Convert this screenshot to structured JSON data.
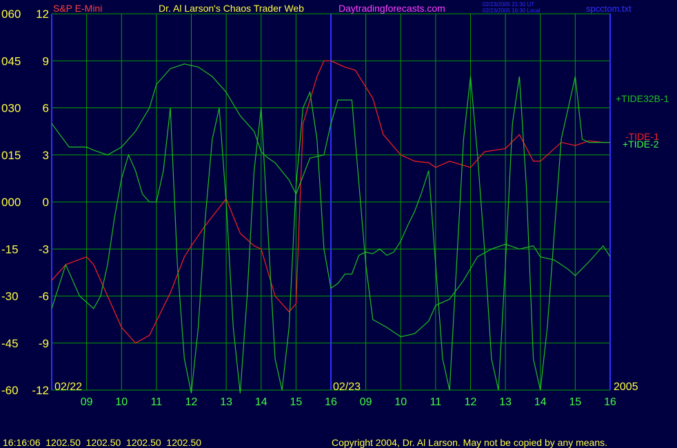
{
  "header": {
    "instrument": "S&P E-Mini",
    "title": "Dr. Al Larson's Chaos Trader Web",
    "site": "Daytradingforecasts.com",
    "stamp1": "02/23/2005 21:30 UT",
    "stamp2": "02/23/2005 16:30 Local",
    "filename": "spcctom.txt"
  },
  "footer": {
    "quote": "16:16:06  1202.50  1202.50  1202.50  1202.50",
    "copyright": "Copyright 2004, Dr. Al Larson. May not be copied by any means."
  },
  "colors": {
    "background": "#000040",
    "grid": "#00A000",
    "axis": "#3030FF",
    "label_yellow": "#FFFF40",
    "label_green": "#40FF40",
    "tide1": "#FF2020",
    "tide2": "#20C020",
    "tide32b": "#20C020",
    "title_pink": "#FF40FF"
  },
  "chart_data": {
    "type": "line",
    "left_axis_ticks": [
      "060",
      "045",
      "030",
      "015",
      "000",
      "-15",
      "-30",
      "-45",
      "-60"
    ],
    "right_axis_ticks": [
      "12",
      "9",
      "6",
      "3",
      "0",
      "-3",
      "-6",
      "-9",
      "-12"
    ],
    "ylim": [
      -12,
      12
    ],
    "date_labels": [
      "02/22",
      "02/23",
      "2005"
    ],
    "x_ticks": [
      "09",
      "10",
      "11",
      "12",
      "13",
      "14",
      "15",
      "16",
      "09",
      "10",
      "11",
      "12",
      "13",
      "14",
      "15",
      "16"
    ],
    "xlim": [
      0,
      16
    ],
    "series": [
      {
        "name": "TIDE-1",
        "x": [
          0,
          0.4,
          1,
          1.2,
          1.6,
          2,
          2.4,
          2.8,
          3,
          3.4,
          3.8,
          4,
          4.4,
          5,
          5.4,
          5.8,
          6,
          6.4,
          6.8,
          7,
          7.2,
          7.6,
          7.8,
          8,
          8.4,
          8.7,
          9.2,
          9.5,
          10,
          10.4,
          10.8,
          11,
          11.4,
          12,
          12.4,
          13,
          13.4,
          13.8,
          14,
          14.6,
          15,
          15.4,
          15.8,
          16
        ],
        "values": [
          -5,
          -4,
          -3.5,
          -4,
          -6,
          -8,
          -9,
          -8.5,
          -7.6,
          -5.8,
          -3.5,
          -2.8,
          -1.5,
          0.2,
          -2,
          -2.8,
          -3,
          -6,
          -7,
          -6.5,
          5,
          8,
          9,
          9,
          8.6,
          8.4,
          6.6,
          4.3,
          3,
          2.6,
          2.5,
          2.2,
          2.6,
          2.2,
          3.2,
          3.4,
          4.3,
          2.6,
          2.6,
          3.8,
          3.6,
          3.9,
          3.8,
          3.8
        ]
      },
      {
        "name": "TIDE-2",
        "x": [
          0,
          0.4,
          0.8,
          1.2,
          1.4,
          1.6,
          1.8,
          2,
          2.2,
          2.4,
          2.6,
          2.8,
          3,
          3.2,
          3.4,
          3.6,
          3.8,
          4,
          4.2,
          4.4,
          4.6,
          4.8,
          5,
          5.2,
          5.4,
          5.6,
          5.8,
          6,
          6.2,
          6.4,
          6.6,
          6.8,
          7,
          7.2,
          7.4,
          7.6,
          7.8,
          8,
          8.2,
          8.4,
          8.6,
          8.8,
          9,
          9.2,
          9.4,
          9.6,
          9.8,
          10,
          10.2,
          10.4,
          10.6,
          10.8,
          11,
          11.2,
          11.4,
          11.6,
          11.8,
          12,
          12.2,
          12.4,
          12.6,
          12.8,
          13,
          13.2,
          13.4,
          13.6,
          13.8,
          14,
          14.2,
          14.4,
          14.6,
          14.8,
          15,
          15.2,
          15.4,
          15.6,
          15.8,
          16
        ],
        "values": [
          -6.8,
          -4,
          -6,
          -6.8,
          -6,
          -4,
          -1,
          1.5,
          3,
          2,
          0.5,
          0,
          0,
          2,
          6,
          -4,
          -10,
          -12.2,
          -8,
          -1,
          4,
          6,
          0,
          -8,
          -12.2,
          -6,
          2,
          6,
          -2,
          -10,
          -12,
          -8,
          1,
          6,
          7,
          4,
          -3,
          -5.5,
          -5.2,
          -4.6,
          -4.6,
          -3.4,
          -3.2,
          -3.3,
          -3,
          -3.4,
          -3.2,
          -2.5,
          -1.5,
          -0.6,
          0.6,
          2,
          -4,
          -10,
          -12,
          -4,
          4,
          8,
          3,
          -3,
          -10,
          -12,
          -4,
          5,
          8,
          1,
          -10,
          -12,
          -8,
          -2,
          4,
          6,
          8,
          4,
          3.8,
          3.8,
          3.8,
          3.8
        ]
      },
      {
        "name": "TIDE32B-1",
        "x": [
          0,
          0.5,
          1,
          1.2,
          1.6,
          2,
          2.4,
          2.8,
          3,
          3.4,
          3.8,
          4.2,
          4.6,
          5,
          5.4,
          5.8,
          6,
          6.2,
          6.4,
          6.8,
          7,
          7.4,
          7.8,
          8,
          8.2,
          8.6,
          9,
          9.2,
          9.6,
          10,
          10.4,
          10.8,
          11,
          11.4,
          11.8,
          12.2,
          12.6,
          13,
          13.4,
          13.8,
          14,
          14.4,
          14.8,
          15,
          15.4,
          15.8,
          16
        ],
        "values": [
          5,
          3.5,
          3.5,
          3.3,
          3,
          3.5,
          4.5,
          6,
          7.5,
          8.5,
          8.8,
          8.6,
          8,
          7,
          5.5,
          4.5,
          3.2,
          2.8,
          2.5,
          1.4,
          0.5,
          2.8,
          3,
          5,
          6.5,
          6.5,
          -4,
          -7.5,
          -8,
          -8.6,
          -8.4,
          -7.6,
          -6.6,
          -6.2,
          -5,
          -3.5,
          -3,
          -2.7,
          -3,
          -2.8,
          -3.5,
          -3.7,
          -4.3,
          -4.7,
          -3.8,
          -2.8,
          -3.5
        ]
      }
    ],
    "series_labels": [
      "+TIDE32B-1",
      "-TIDE-1",
      "+TIDE-2"
    ],
    "grid": true
  }
}
